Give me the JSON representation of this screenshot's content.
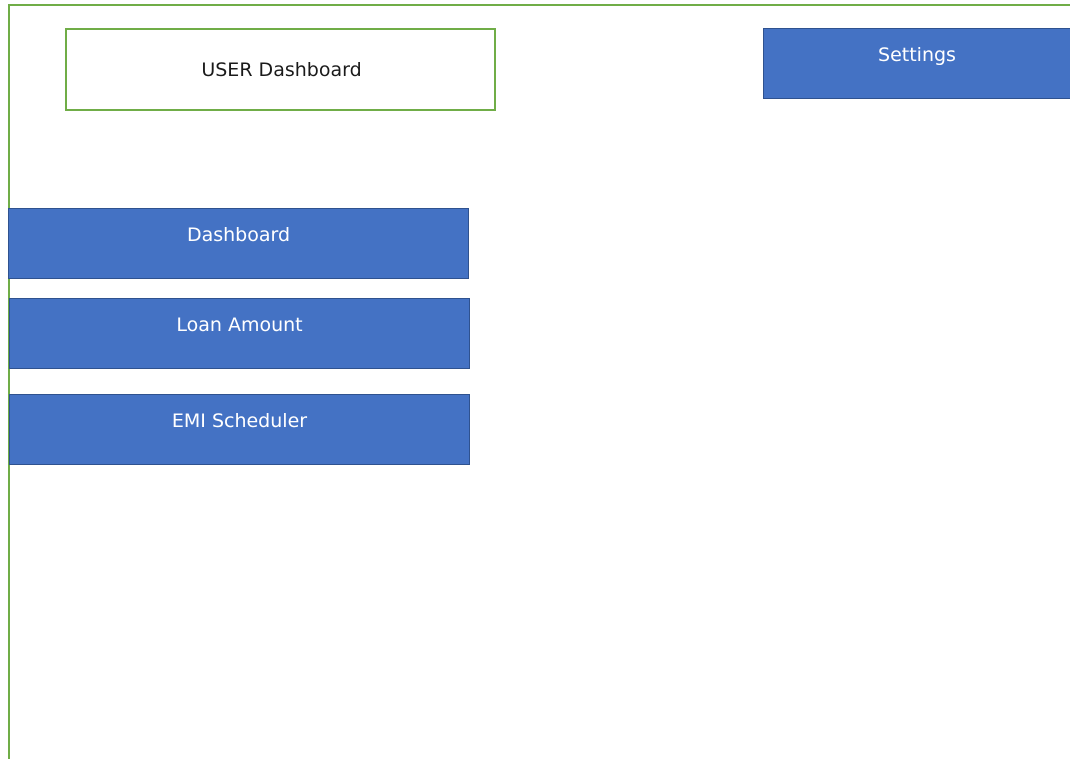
{
  "header": {
    "title": "USER Dashboard",
    "settings_label": "Settings"
  },
  "nav": {
    "items": [
      {
        "label": "Dashboard"
      },
      {
        "label": "Loan Amount"
      },
      {
        "label": "EMI Scheduler"
      }
    ]
  },
  "colors": {
    "button_fill": "#4472c4",
    "button_border": "#2f528f",
    "frame_border": "#70ad47",
    "button_text": "#ffffff"
  }
}
